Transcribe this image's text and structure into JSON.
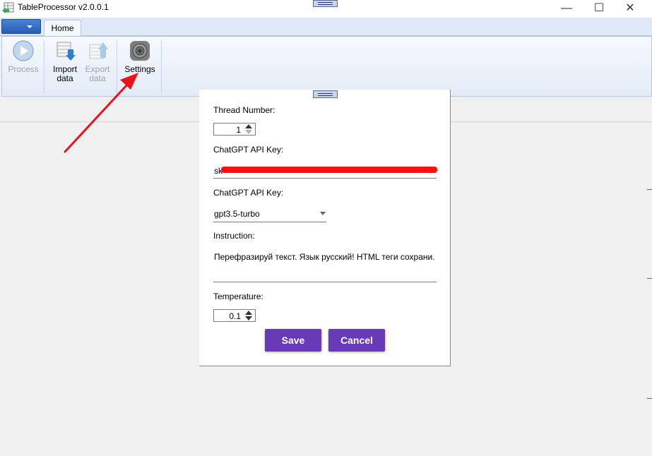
{
  "window": {
    "title": "TableProcessor v2.0.0.1",
    "min_glyph": "—",
    "max_glyph": "☐",
    "close_glyph": "✕"
  },
  "ribbon": {
    "tabs": [
      {
        "label": "Home"
      }
    ],
    "buttons": [
      {
        "label": "Process",
        "icon": "play-icon",
        "enabled": false
      },
      {
        "label": "Import data",
        "label_line1": "Import",
        "label_line2": "data",
        "icon": "import-data-icon",
        "enabled": true
      },
      {
        "label": "Export data",
        "label_line1": "Export",
        "label_line2": "data",
        "icon": "export-data-icon",
        "enabled": false
      },
      {
        "label": "Settings",
        "icon": "gear-icon",
        "enabled": true
      }
    ]
  },
  "settings": {
    "thread_label": "Thread Number:",
    "thread_value": "1",
    "api_key_label": "ChatGPT API Key:",
    "api_key_value": "sk-",
    "model_label": "ChatGPT API Key:",
    "model_value": "gpt3.5-turbo",
    "instruction_label": "Instruction:",
    "instruction_value": "Перефразируй текст. Язык русский! HTML теги сохрани.",
    "temperature_label": "Temperature:",
    "temperature_value": "0.1",
    "save_label": "Save",
    "cancel_label": "Cancel"
  },
  "colors": {
    "accent": "#673ab7",
    "annotation_arrow": "#e8141c",
    "redaction": "#ff1010"
  }
}
